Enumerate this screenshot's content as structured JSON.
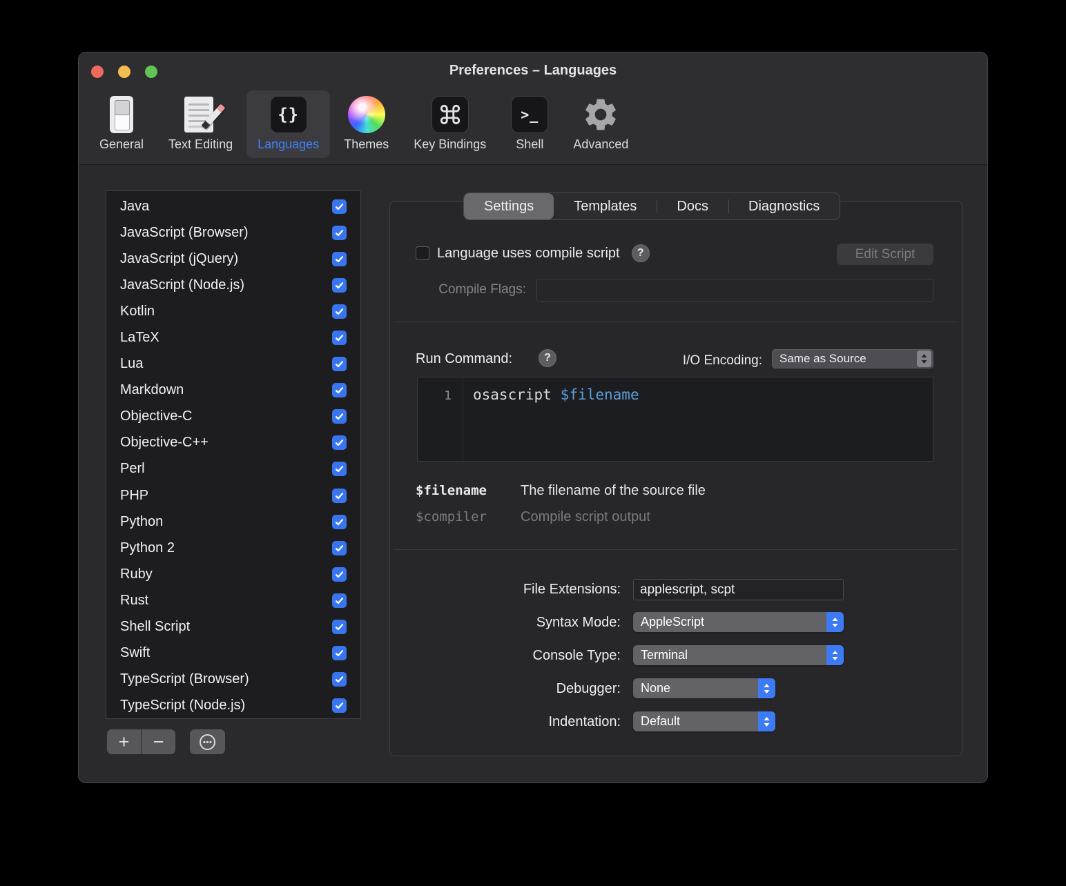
{
  "colors": {
    "accent": "#3d7bf4",
    "checkbox": "#3a75f0",
    "selected_label": "#3f82f7"
  },
  "window": {
    "title": "Preferences – Languages"
  },
  "toolbar": {
    "items": [
      {
        "id": "general",
        "label": "General"
      },
      {
        "id": "text-editing",
        "label": "Text Editing"
      },
      {
        "id": "languages",
        "label": "Languages",
        "selected": true
      },
      {
        "id": "themes",
        "label": "Themes"
      },
      {
        "id": "key-bindings",
        "label": "Key Bindings"
      },
      {
        "id": "shell",
        "label": "Shell"
      },
      {
        "id": "advanced",
        "label": "Advanced"
      }
    ],
    "braces_glyph": "{}",
    "shell_glyph": ">_"
  },
  "languages": {
    "items": [
      {
        "name": "Java",
        "checked": true
      },
      {
        "name": "JavaScript (Browser)",
        "checked": true
      },
      {
        "name": "JavaScript (jQuery)",
        "checked": true
      },
      {
        "name": "JavaScript (Node.js)",
        "checked": true
      },
      {
        "name": "Kotlin",
        "checked": true
      },
      {
        "name": "LaTeX",
        "checked": true
      },
      {
        "name": "Lua",
        "checked": true
      },
      {
        "name": "Markdown",
        "checked": true
      },
      {
        "name": "Objective-C",
        "checked": true
      },
      {
        "name": "Objective-C++",
        "checked": true
      },
      {
        "name": "Perl",
        "checked": true
      },
      {
        "name": "PHP",
        "checked": true
      },
      {
        "name": "Python",
        "checked": true
      },
      {
        "name": "Python 2",
        "checked": true
      },
      {
        "name": "Ruby",
        "checked": true
      },
      {
        "name": "Rust",
        "checked": true
      },
      {
        "name": "Shell Script",
        "checked": true
      },
      {
        "name": "Swift",
        "checked": true
      },
      {
        "name": "TypeScript (Browser)",
        "checked": true
      },
      {
        "name": "TypeScript (Node.js)",
        "checked": true
      }
    ],
    "add_label": "+",
    "remove_label": "−"
  },
  "tabs": {
    "items": [
      {
        "label": "Settings",
        "selected": true
      },
      {
        "label": "Templates"
      },
      {
        "label": "Docs"
      },
      {
        "label": "Diagnostics"
      }
    ]
  },
  "compile": {
    "checkbox_label": "Language uses compile script",
    "checked": false,
    "help_glyph": "?",
    "edit_script_label": "Edit Script",
    "flags_label": "Compile Flags:",
    "flags_value": ""
  },
  "run": {
    "label": "Run Command:",
    "help_glyph": "?",
    "encoding_label": "I/O Encoding:",
    "encoding_value": "Same as Source",
    "line_number": "1",
    "command": "osascript",
    "argument": "$filename"
  },
  "variables": [
    {
      "name": "$filename",
      "desc": "The filename of the source file"
    },
    {
      "name": "$compiler",
      "desc": "Compile script output"
    }
  ],
  "form": {
    "rows": [
      {
        "label": "File Extensions:",
        "value": "applescript, scpt"
      },
      {
        "label": "Syntax Mode:",
        "value": "AppleScript"
      },
      {
        "label": "Console Type:",
        "value": "Terminal"
      },
      {
        "label": "Debugger:",
        "value": "None"
      },
      {
        "label": "Indentation:",
        "value": "Default"
      }
    ]
  }
}
